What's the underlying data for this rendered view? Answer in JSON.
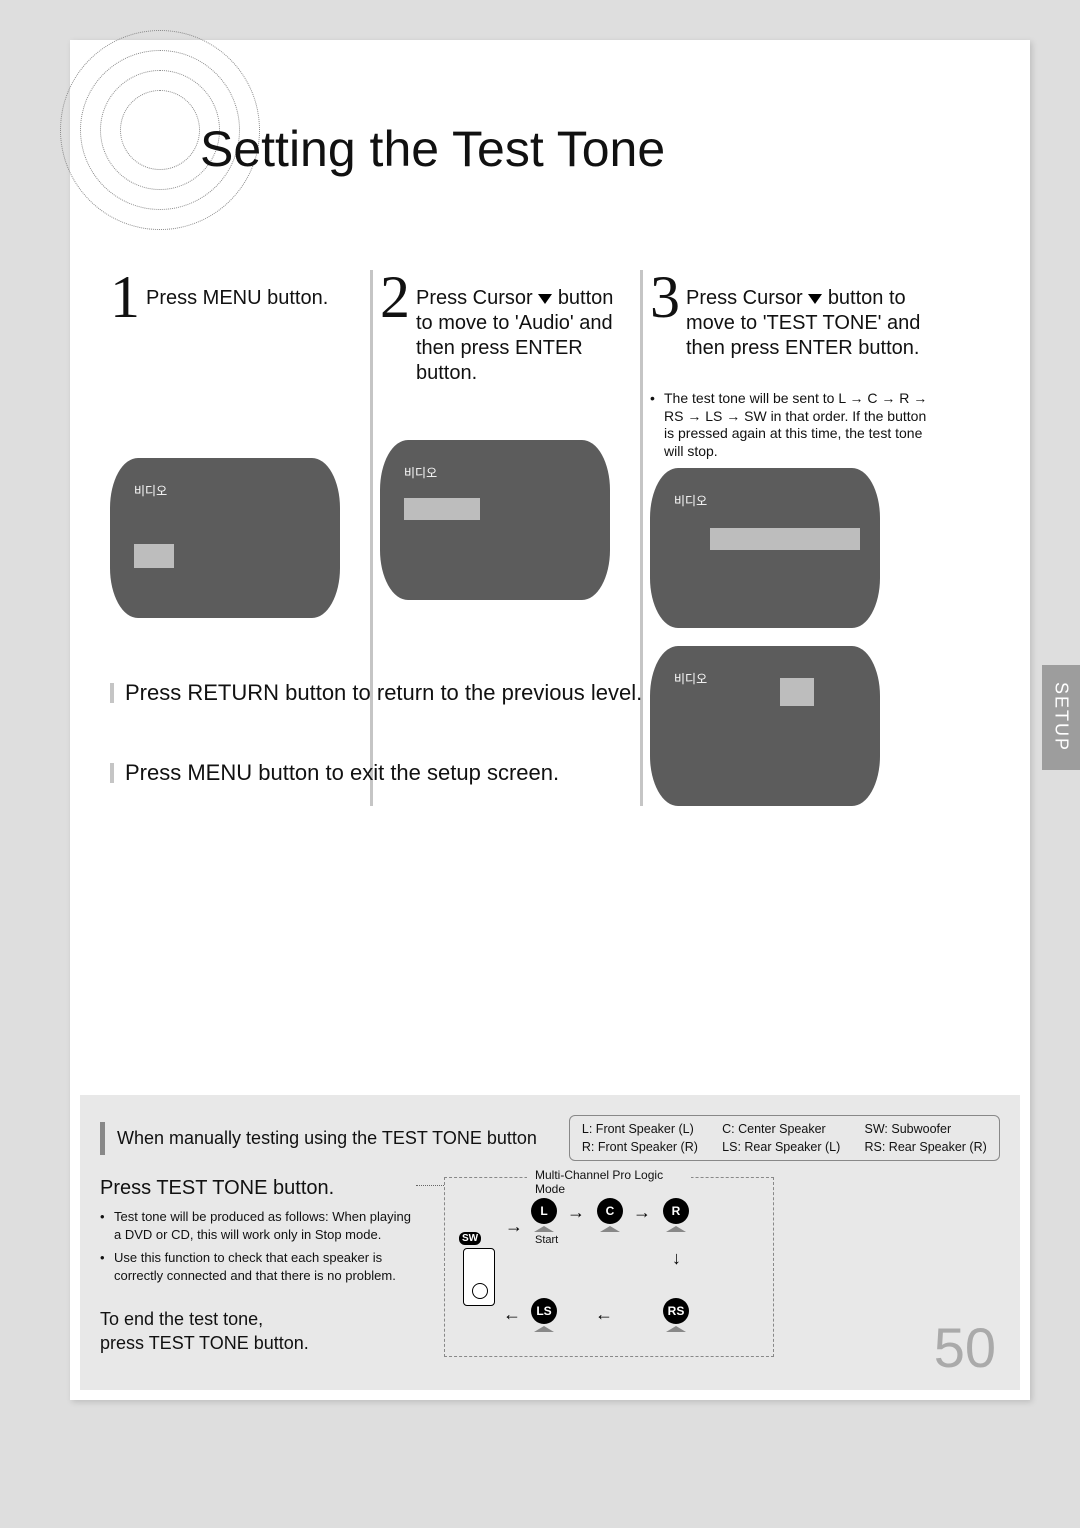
{
  "title": "Setting the Test Tone",
  "side_tab": "SETUP",
  "steps": {
    "s1": {
      "num": "1",
      "text": "Press MENU button."
    },
    "s2": {
      "num": "2",
      "text_pre": "Press Cursor ",
      "text_post": " button to move to 'Audio' and then press ENTER button."
    },
    "s3": {
      "num": "3",
      "text_pre": "Press Cursor ",
      "text_post": " button to move to 'TEST TONE' and then press ENTER button.",
      "bullet": "The test tone will be sent to L → C → R → RS → LS → SW in that order. If the button is pressed again at this time, the test tone will stop."
    }
  },
  "screen_label": "비디오",
  "return_line": "Press RETURN button to return to the previous level.",
  "menu_line": "Press MENU button to exit the setup screen.",
  "bottom": {
    "manual": "When manually testing using the TEST TONE button",
    "legend": {
      "l": "L: Front Speaker (L)",
      "c": "C: Center Speaker",
      "sw": "SW: Subwoofer",
      "r": "R: Front Speaker (R)",
      "ls": "LS: Rear Speaker (L)",
      "rs": "RS: Rear Speaker (R)"
    },
    "sub": "Press TEST TONE button.",
    "b1": "Test tone will be produced as follows: When playing a DVD or CD, this will work only in Stop mode.",
    "b2": "Use this function to check that each speaker is correctly connected and that there is no problem.",
    "end": "To end the test tone,\npress TEST TONE button.",
    "diagram_title": "Multi-Channel Pro Logic Mode",
    "start_label": "Start",
    "spk": {
      "L": "L",
      "C": "C",
      "R": "R",
      "LS": "LS",
      "RS": "RS",
      "SW": "SW"
    }
  },
  "page_number": "50"
}
